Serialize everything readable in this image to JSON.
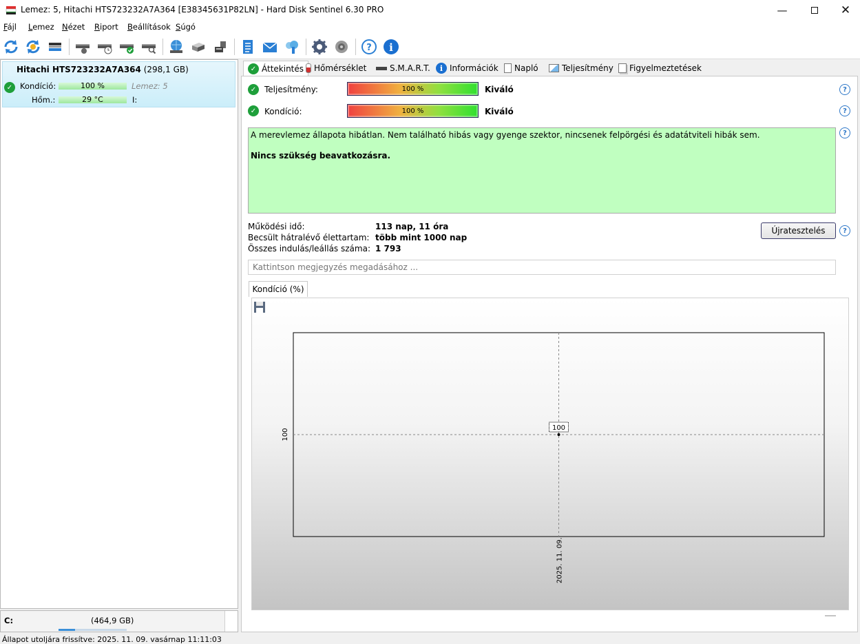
{
  "window": {
    "title": "Lemez: 5, Hitachi HTS723232A7A364 [E38345631P82LN]  -  Hard Disk Sentinel 6.30 PRO",
    "min_icon": "minimize-icon",
    "max_icon": "maximize-icon",
    "close_icon": "close-icon"
  },
  "menu": [
    {
      "accel": "F",
      "rest": "ájl"
    },
    {
      "accel": "L",
      "rest": "emez"
    },
    {
      "accel": "N",
      "rest": "ézet"
    },
    {
      "accel": "R",
      "rest": "iport"
    },
    {
      "accel": "B",
      "rest": "eállítások"
    },
    {
      "accel": "S",
      "rest": "úgó"
    }
  ],
  "toolbar_icons": [
    "refresh-icon",
    "refresh-all-icon",
    "disk-list-icon",
    "disk-test-icon",
    "disk-schedule-icon",
    "disk-ok-icon",
    "disk-search-icon",
    "network-icon",
    "server-icon",
    "usb-icon",
    "report-icon",
    "email-icon",
    "cloud-icon",
    "settings-icon",
    "sound-icon",
    "help-icon",
    "info-icon"
  ],
  "disk": {
    "name": "Hitachi HTS723232A7A364",
    "size": "(298,1 GB)",
    "condition_label": "Kondíció:",
    "condition_value": "100 %",
    "condition_fraction": 1.0,
    "disk_number": "Lemez: 5",
    "temp_label": "Hőm.:",
    "temp_value": "29 °C",
    "partition": "I:"
  },
  "drive_c": {
    "letter": "C:",
    "size": "(464,9 GB)"
  },
  "status": "Állapot utoljára frissítve: 2025. 11. 09. vasárnap 11:11:03",
  "tabs": [
    "Áttekintés",
    "Hőmérséklet",
    "S.M.A.R.T.",
    "Információk",
    "Napló",
    "Teljesítmény",
    "Figyelmeztetések"
  ],
  "overview": {
    "performance_label": "Teljesítmény:",
    "performance_value": "100 %",
    "performance_rating": "Kiváló",
    "condition_label": "Kondíció:",
    "condition_value": "100 %",
    "condition_rating": "Kiváló",
    "message": "A merevlemez állapota hibátlan. Nem található hibás vagy gyenge szektor, nincsenek felpörgési és adatátviteli hibák sem.",
    "recommendation": "Nincs szükség beavatkozásra.",
    "uptime_label": "Működési idő:",
    "uptime_value": "113 nap, 11 óra",
    "lifetime_label": "Becsült hátralévő élettartam:",
    "lifetime_value": "több mint 1000 nap",
    "startstop_label": "Összes indulás/leállás száma:",
    "startstop_value": "1 793",
    "retest_button": "Újratesztelés",
    "note_placeholder": "Kattintson megjegyzés megadásához ..."
  },
  "chart_tab": "Kondíció  (%)",
  "chart_data": {
    "type": "line",
    "title": "",
    "x": [
      "2025. 11. 09."
    ],
    "series": [
      {
        "values": [
          100
        ]
      }
    ],
    "ytick": "100",
    "data_label": "100",
    "ylabel": "",
    "xlabel": ""
  }
}
